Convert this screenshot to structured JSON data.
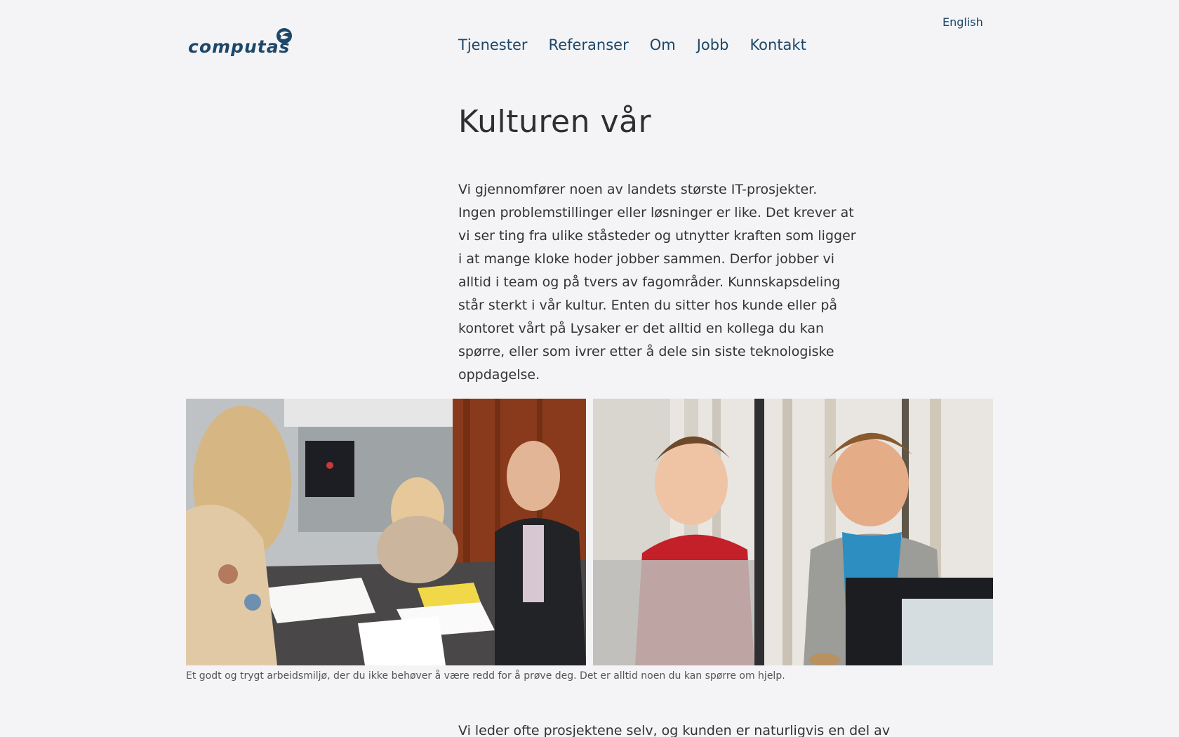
{
  "header": {
    "language_link": "English",
    "logo_text": "computas",
    "nav": [
      "Tjenester",
      "Referanser",
      "Om",
      "Jobb",
      "Kontakt"
    ]
  },
  "main": {
    "title": "Kulturen vår",
    "intro": "Vi gjennomfører noen av landets største IT-prosjekter. Ingen problemstillinger eller løsninger er like. Det krever at vi ser ting fra ulike ståsteder og utnytter kraften som ligger i at mange kloke hoder jobber sammen. Derfor jobber vi alltid i team og på tvers av fagområder. Kunnskapsdeling står sterkt i vår kultur. Enten du sitter hos kunde eller på kontoret vårt på Lysaker er det alltid en kollega du kan spørre, eller som ivrer etter å dele sin siste teknologiske oppdagelse.",
    "photo_caption": "Et godt og trygt arbeidsmiljø, der du ikke behøver å være redd for å prøve deg. Det er alltid noen du kan spørre om hjelp.",
    "outro": "Vi leder ofte prosjektene selv, og kunden er naturligvis en del av"
  },
  "colors": {
    "brand": "#1d4768",
    "background": "#f4f4f6",
    "text": "#2b2b2b"
  }
}
